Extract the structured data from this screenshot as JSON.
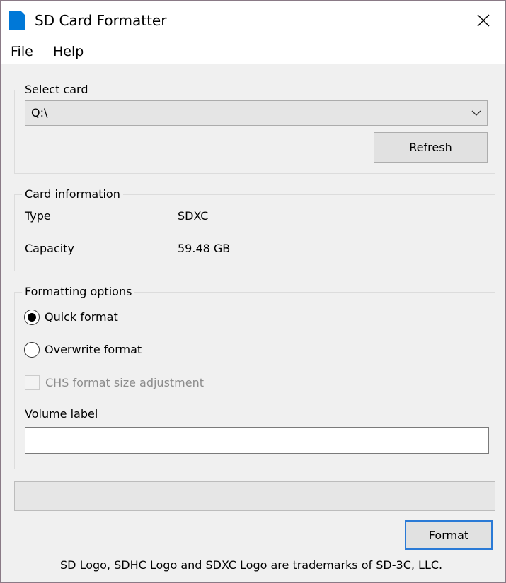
{
  "window": {
    "title": "SD Card Formatter",
    "close_glyph": "✕",
    "accent_color": "#0078d7"
  },
  "menu": {
    "items": [
      "File",
      "Help"
    ]
  },
  "select_card": {
    "legend": "Select card",
    "selected": "Q:\\",
    "refresh_label": "Refresh"
  },
  "card_info": {
    "legend": "Card information",
    "type_label": "Type",
    "type_value": "SDXC",
    "capacity_label": "Capacity",
    "capacity_value": "59.48 GB"
  },
  "formatting": {
    "legend": "Formatting options",
    "quick_label": "Quick format",
    "quick_checked": true,
    "overwrite_label": "Overwrite format",
    "overwrite_checked": false,
    "chs_label": "CHS format size adjustment",
    "chs_enabled": false,
    "volume_label_caption": "Volume label",
    "volume_label_value": ""
  },
  "progress": {
    "fraction": 0
  },
  "actions": {
    "format_label": "Format"
  },
  "footer": {
    "trademark": "SD Logo, SDHC Logo and SDXC Logo are trademarks of SD-3C, LLC."
  },
  "icons": {
    "app": "sd-card-icon",
    "close": "close-icon",
    "dropdown": "chevron-down-icon"
  }
}
